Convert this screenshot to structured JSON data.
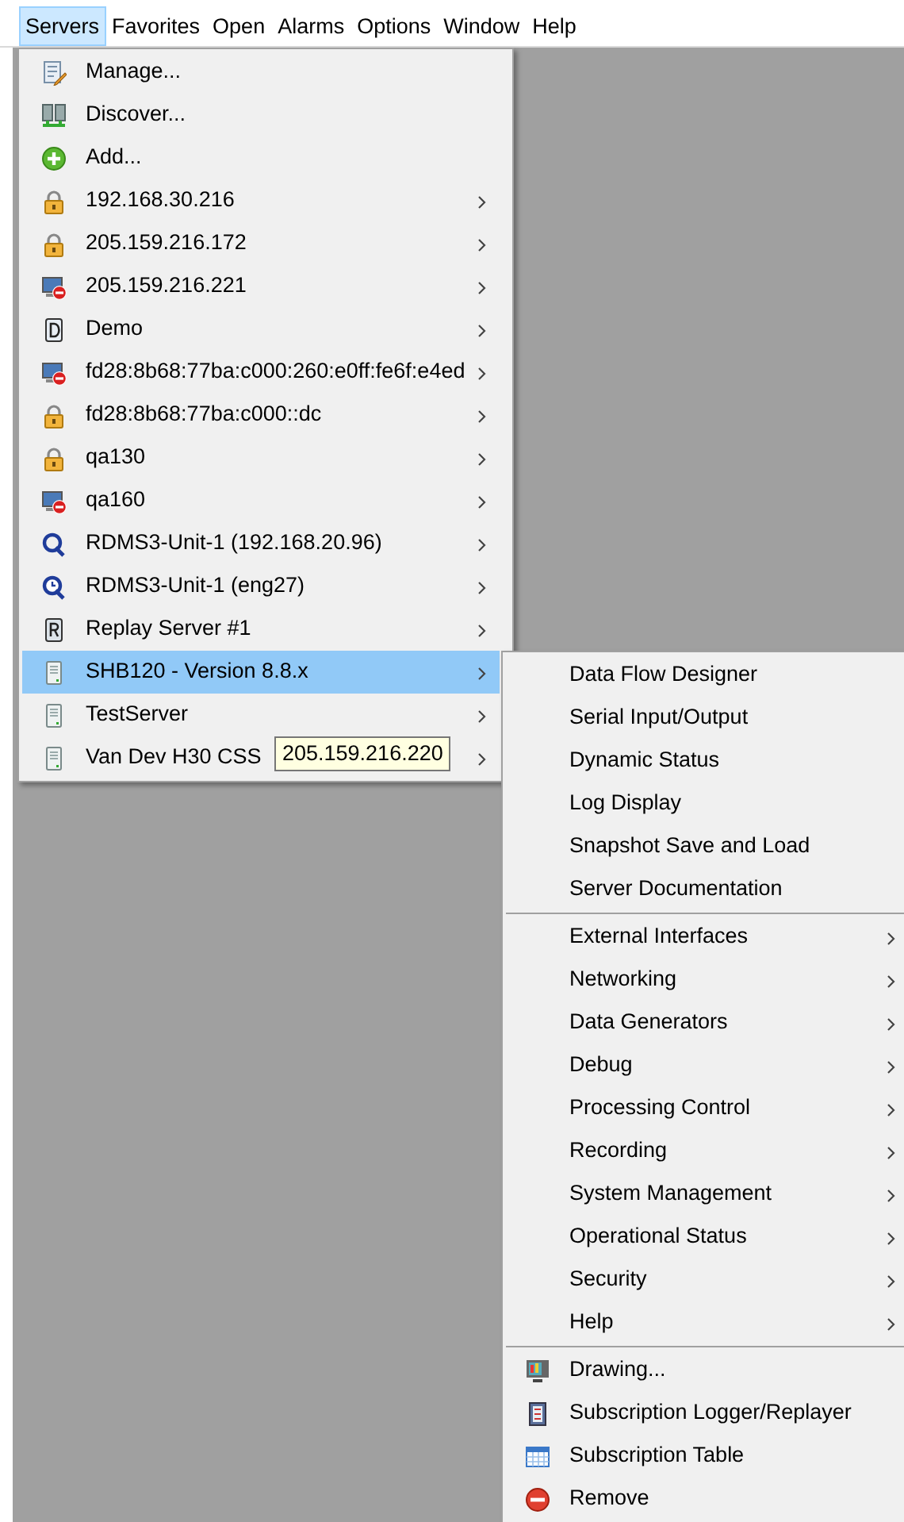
{
  "menubar": [
    {
      "label": "Servers",
      "selected": true
    },
    {
      "label": "Favorites",
      "selected": false
    },
    {
      "label": "Open",
      "selected": false
    },
    {
      "label": "Alarms",
      "selected": false
    },
    {
      "label": "Options",
      "selected": false
    },
    {
      "label": "Window",
      "selected": false
    },
    {
      "label": "Help",
      "selected": false
    }
  ],
  "servers_menu": [
    {
      "kind": "edit",
      "label": "Manage...",
      "has_submenu": false,
      "selected": false
    },
    {
      "kind": "discover",
      "label": "Discover...",
      "has_submenu": false,
      "selected": false
    },
    {
      "kind": "add",
      "label": "Add...",
      "has_submenu": false,
      "selected": false
    },
    {
      "kind": "lock",
      "label": "192.168.30.216",
      "has_submenu": true,
      "selected": false
    },
    {
      "kind": "lock",
      "label": "205.159.216.172",
      "has_submenu": true,
      "selected": false
    },
    {
      "kind": "offline",
      "label": "205.159.216.221",
      "has_submenu": true,
      "selected": false
    },
    {
      "kind": "letter-d",
      "label": "Demo",
      "has_submenu": true,
      "selected": false
    },
    {
      "kind": "offline",
      "label": "fd28:8b68:77ba:c000:260:e0ff:fe6f:e4ed",
      "has_submenu": true,
      "selected": false
    },
    {
      "kind": "lock",
      "label": "fd28:8b68:77ba:c000::dc",
      "has_submenu": true,
      "selected": false
    },
    {
      "kind": "lock",
      "label": "qa130",
      "has_submenu": true,
      "selected": false
    },
    {
      "kind": "offline",
      "label": "qa160",
      "has_submenu": true,
      "selected": false
    },
    {
      "kind": "rdms",
      "label": "RDMS3-Unit-1 (192.168.20.96)",
      "has_submenu": true,
      "selected": false
    },
    {
      "kind": "rdms-clock",
      "label": "RDMS3-Unit-1 (eng27)",
      "has_submenu": true,
      "selected": false
    },
    {
      "kind": "letter-r",
      "label": "Replay Server #1",
      "has_submenu": true,
      "selected": false
    },
    {
      "kind": "server",
      "label": "SHB120 - Version 8.8.x",
      "has_submenu": true,
      "selected": true
    },
    {
      "kind": "server",
      "label": "TestServer",
      "has_submenu": true,
      "selected": false
    },
    {
      "kind": "server",
      "label": "Van Dev H30 CSS",
      "has_submenu": true,
      "selected": false
    }
  ],
  "tooltip": "205.159.216.220",
  "server_submenu": [
    [
      {
        "kind": "none",
        "label": "Data Flow Designer",
        "has_submenu": false
      },
      {
        "kind": "none",
        "label": "Serial Input/Output",
        "has_submenu": false
      },
      {
        "kind": "none",
        "label": "Dynamic Status",
        "has_submenu": false
      },
      {
        "kind": "none",
        "label": "Log Display",
        "has_submenu": false
      },
      {
        "kind": "none",
        "label": "Snapshot Save and Load",
        "has_submenu": false
      },
      {
        "kind": "none",
        "label": "Server Documentation",
        "has_submenu": false
      }
    ],
    [
      {
        "kind": "none",
        "label": "External Interfaces",
        "has_submenu": true
      },
      {
        "kind": "none",
        "label": "Networking",
        "has_submenu": true
      },
      {
        "kind": "none",
        "label": "Data Generators",
        "has_submenu": true
      },
      {
        "kind": "none",
        "label": "Debug",
        "has_submenu": true
      },
      {
        "kind": "none",
        "label": "Processing Control",
        "has_submenu": true
      },
      {
        "kind": "none",
        "label": "Recording",
        "has_submenu": true
      },
      {
        "kind": "none",
        "label": "System Management",
        "has_submenu": true
      },
      {
        "kind": "none",
        "label": "Operational Status",
        "has_submenu": true
      },
      {
        "kind": "none",
        "label": "Security",
        "has_submenu": true
      },
      {
        "kind": "none",
        "label": "Help",
        "has_submenu": true
      }
    ],
    [
      {
        "kind": "drawing",
        "label": "Drawing...",
        "has_submenu": false
      },
      {
        "kind": "logger",
        "label": "Subscription Logger/Replayer",
        "has_submenu": false
      },
      {
        "kind": "table",
        "label": "Subscription Table",
        "has_submenu": false
      },
      {
        "kind": "remove",
        "label": "Remove",
        "has_submenu": false
      }
    ]
  ]
}
